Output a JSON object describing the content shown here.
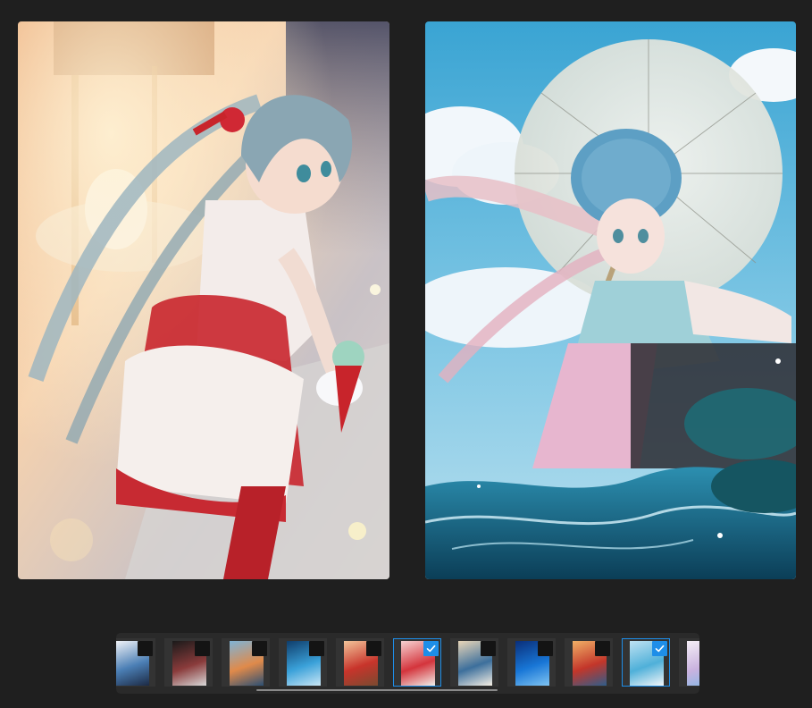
{
  "viewer": {
    "left_image": {
      "name": "carousel-girl-illustration",
      "palette": {
        "bg_top": "#f3c9a0",
        "bg_mid": "#e9a88a",
        "bg_bottom": "#cfc7c9",
        "dress_red": "#c8242b",
        "dress_white": "#f4eeea",
        "hair": "#8aa6b3",
        "accent": "#ffd9a0"
      }
    },
    "right_image": {
      "name": "umbrella-girl-illustration",
      "palette": {
        "sky": "#4fb0d9",
        "sky_light": "#bfe4f2",
        "cloud": "#f2f7fb",
        "umbrella": "#e8ecea",
        "water": "#1c6e8d",
        "water_dark": "#0d3f55",
        "dress_pink": "#e7b6cf",
        "headdress": "#5d9fc4"
      }
    }
  },
  "filmstrip": {
    "thumbnails": [
      {
        "label": "thumb-1",
        "selected": false,
        "colors": [
          "#f2f4f8",
          "#4b7fb5",
          "#1c2a44"
        ]
      },
      {
        "label": "thumb-2",
        "selected": false,
        "colors": [
          "#1a1a1a",
          "#8a3b3b",
          "#d8d8d8"
        ]
      },
      {
        "label": "thumb-3",
        "selected": false,
        "colors": [
          "#7fb3d6",
          "#e08a4a",
          "#2c4f73"
        ]
      },
      {
        "label": "thumb-4",
        "selected": false,
        "colors": [
          "#0f3d6b",
          "#3aa1d9",
          "#c9e6f5"
        ]
      },
      {
        "label": "thumb-5",
        "selected": false,
        "colors": [
          "#f2c49a",
          "#c8342b",
          "#7a4a30"
        ]
      },
      {
        "label": "thumb-6",
        "selected": true,
        "colors": [
          "#f7d2d2",
          "#d4343c",
          "#f2efe9"
        ]
      },
      {
        "label": "thumb-7",
        "selected": false,
        "colors": [
          "#e9d6b8",
          "#3c6f9c",
          "#f5efe4"
        ]
      },
      {
        "label": "thumb-8",
        "selected": false,
        "colors": [
          "#0a2f7a",
          "#1876d6",
          "#7fc4f2"
        ]
      },
      {
        "label": "thumb-9",
        "selected": false,
        "colors": [
          "#f0b066",
          "#c3362a",
          "#2f5d8a"
        ]
      },
      {
        "label": "thumb-10",
        "selected": true,
        "colors": [
          "#bfe2f2",
          "#4fb0d9",
          "#f3f6f8"
        ]
      },
      {
        "label": "thumb-11",
        "selected": false,
        "colors": [
          "#f4eef6",
          "#c9b2de",
          "#7fb8e6"
        ]
      }
    ],
    "scroll_fraction": 0.41
  }
}
